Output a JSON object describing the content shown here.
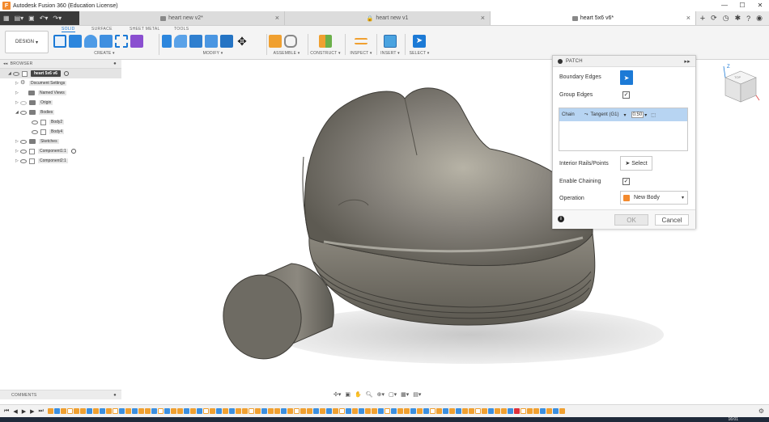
{
  "window": {
    "title": "Autodesk Fusion 360 (Education License)",
    "logo": "F",
    "controls": [
      "—",
      "☐",
      "✕"
    ]
  },
  "tabs": [
    {
      "label": "heart new v2*",
      "active": false
    },
    {
      "label": "heart new v1",
      "active": false
    },
    {
      "label": "heart 5x6 v6*",
      "active": true
    }
  ],
  "toolbar": {
    "workspace": "DESIGN",
    "workspace_tabs": [
      "SOLID",
      "SURFACE",
      "SHEET METAL",
      "TOOLS"
    ],
    "groups": [
      {
        "label": "CREATE ▾"
      },
      {
        "label": "MODIFY ▾"
      },
      {
        "label": "ASSEMBLE ▾"
      },
      {
        "label": "CONSTRUCT ▾"
      },
      {
        "label": "INSPECT ▾"
      },
      {
        "label": "INSERT ▾"
      },
      {
        "label": "SELECT ▾"
      }
    ]
  },
  "browser": {
    "title": "BROWSER",
    "root": "heart 5x6 v6",
    "items": [
      {
        "label": "Document Settings"
      },
      {
        "label": "Named Views"
      },
      {
        "label": "Origin"
      },
      {
        "label": "Bodies"
      },
      {
        "label": "Body2"
      },
      {
        "label": "Body4"
      },
      {
        "label": "Sketches"
      },
      {
        "label": "Component1:1"
      },
      {
        "label": "Component2:1"
      }
    ]
  },
  "patch": {
    "title": "PATCH",
    "boundary_edges": "Boundary Edges",
    "group_edges": "Group Edges",
    "chain_label": "Chain",
    "chain_type": "Tangent (G1)",
    "chain_value": "0.50",
    "interior_rails": "Interior Rails/Points",
    "select_label": "Select",
    "enable_chaining": "Enable Chaining",
    "operation_label": "Operation",
    "operation_value": "New Body",
    "ok": "OK",
    "cancel": "Cancel",
    "info": "i"
  },
  "viewcube": {
    "axis_z": "Z",
    "face": "TOP"
  },
  "comments": {
    "title": "COMMENTS"
  },
  "taskbar": {
    "time": "16:01"
  },
  "colors": {
    "accent": "#1c7ad6",
    "body": "#7a7668",
    "highlight": "#b7d4f2"
  }
}
